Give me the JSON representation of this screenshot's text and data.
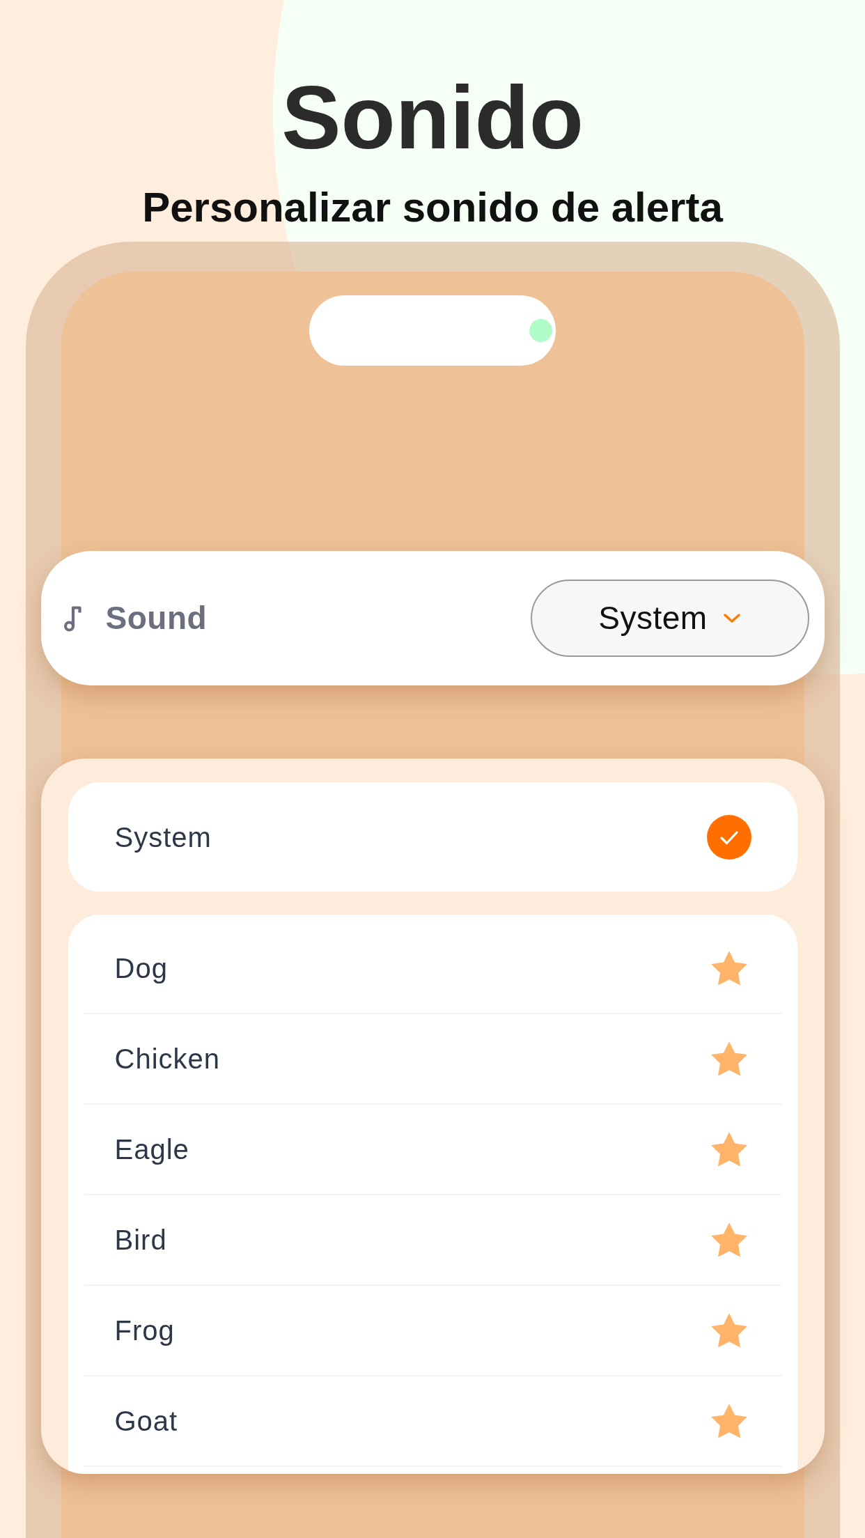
{
  "header": {
    "title": "Sonido",
    "subtitle": "Personalizar sonido de alerta"
  },
  "setting": {
    "label": "Sound",
    "dropdown": {
      "value": "System"
    }
  },
  "options": [
    {
      "label": "System",
      "selected": true
    }
  ],
  "sounds": [
    {
      "label": "Dog",
      "selected": false
    },
    {
      "label": "Chicken",
      "selected": false
    },
    {
      "label": "Eagle",
      "selected": false
    },
    {
      "label": "Bird",
      "selected": false
    },
    {
      "label": "Frog",
      "selected": false
    },
    {
      "label": "Goat",
      "selected": false
    }
  ]
}
